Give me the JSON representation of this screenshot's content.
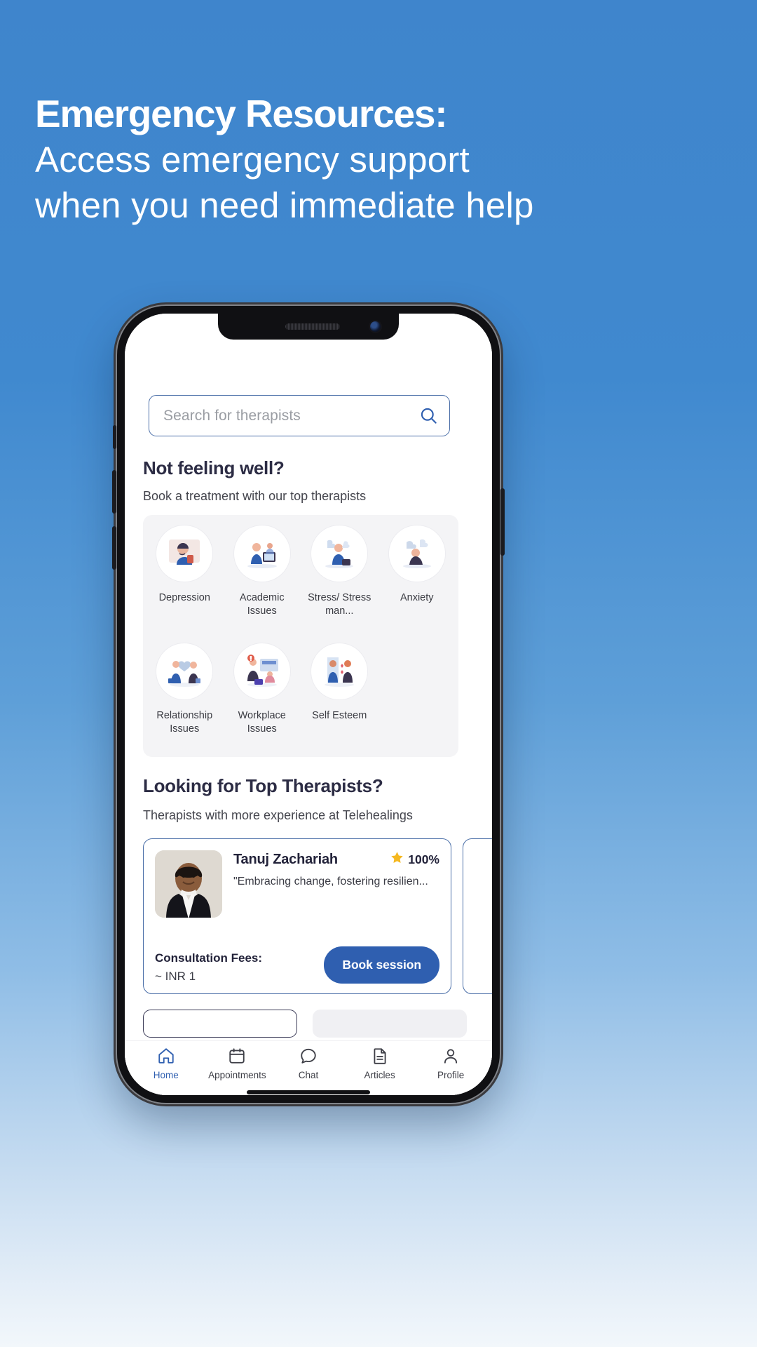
{
  "promo": {
    "headline_bold": "Emergency Resources:",
    "headline_line2": "Access emergency support",
    "headline_line3": "when you need immediate help",
    "bg_top_color": "#3f85cc",
    "bg_bottom_color": "#f2f7fb"
  },
  "app": {
    "search": {
      "placeholder": "Search for therapists",
      "icon": "search-icon",
      "border_color": "#4b6fa8"
    },
    "section_categories": {
      "title": "Not feeling well?",
      "subtitle": "Book a treatment with our top therapists",
      "items": [
        {
          "label": "Depression",
          "icon": "depression-illustration"
        },
        {
          "label": "Academic Issues",
          "icon": "academic-issues-illustration"
        },
        {
          "label": "Stress/ Stress man...",
          "icon": "stress-management-illustration"
        },
        {
          "label": "Anxiety",
          "icon": "anxiety-illustration"
        },
        {
          "label": "Relationship Issues",
          "icon": "relationship-issues-illustration"
        },
        {
          "label": "Workplace Issues",
          "icon": "workplace-issues-illustration"
        },
        {
          "label": "Self Esteem",
          "icon": "self-esteem-illustration"
        }
      ]
    },
    "section_therapists": {
      "title": "Looking for Top Therapists?",
      "subtitle": "Therapists with more experience at Telehealings",
      "card": {
        "name": "Tanuj Zachariah",
        "rating_icon": "star-icon",
        "rating_value": "100%",
        "quote": "\"Embracing change, fostering resilien...",
        "fees_label": "Consultation Fees:",
        "fees_value": "~ INR 1",
        "book_label": "Book session",
        "accent_color": "#2f5fb0"
      }
    },
    "tabbar": {
      "items": [
        {
          "label": "Home",
          "icon": "home-icon",
          "active": true
        },
        {
          "label": "Appointments",
          "icon": "calendar-icon",
          "active": false
        },
        {
          "label": "Chat",
          "icon": "chat-bubble-icon",
          "active": false
        },
        {
          "label": "Articles",
          "icon": "document-icon",
          "active": false
        },
        {
          "label": "Profile",
          "icon": "person-icon",
          "active": false
        }
      ],
      "active_color": "#2f5fb0"
    }
  }
}
